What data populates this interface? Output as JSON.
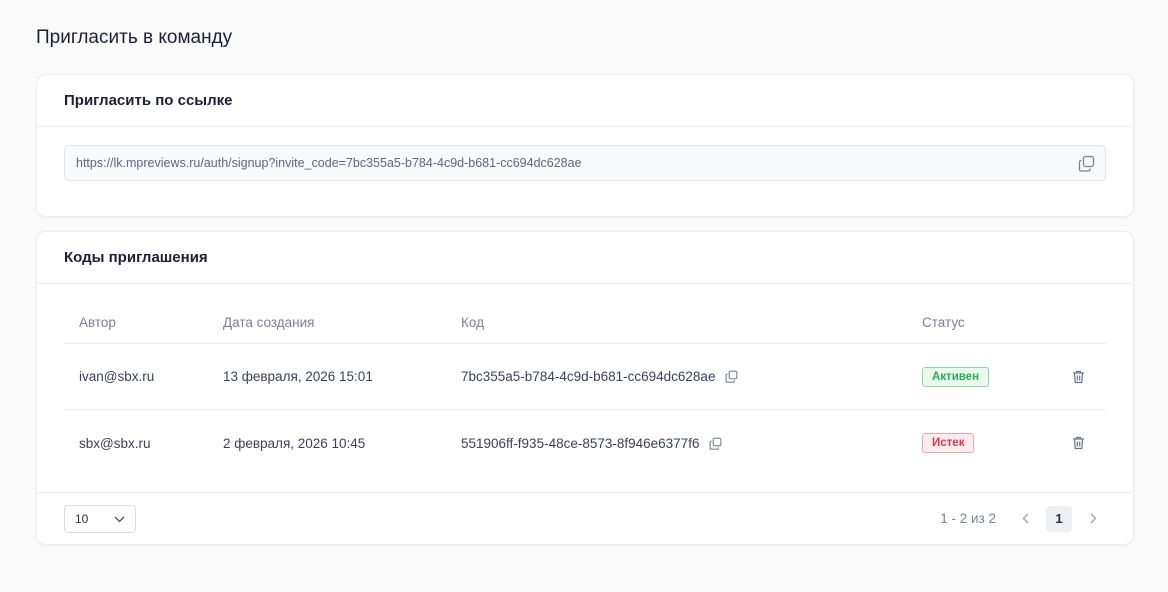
{
  "page": {
    "title": "Пригласить в команду"
  },
  "invite_link": {
    "title": "Пригласить по ссылке",
    "url": "https://lk.mpreviews.ru/auth/signup?invite_code=7bc355a5-b784-4c9d-b681-cc694dc628ae",
    "copy_icon": "copy-icon"
  },
  "codes": {
    "title": "Коды приглашения",
    "columns": {
      "author": "Автор",
      "date": "Дата создания",
      "code": "Код",
      "status": "Статус"
    },
    "rows": [
      {
        "author": "ivan@sbx.ru",
        "date": "13 февраля, 2026 15:01",
        "code": "7bc355a5-b784-4c9d-b681-cc694dc628ae",
        "status": "Активен",
        "status_color": "#2faa55"
      },
      {
        "author": "sbx@sbx.ru",
        "date": "2 февраля, 2026 10:45",
        "code": "551906ff-f935-48ce-8573-8f946e6377f6",
        "status": "Истек",
        "status_color": "#e0384f"
      }
    ]
  },
  "pagination": {
    "page_size": "10",
    "range": "1 - 2 из 2",
    "current_page": "1",
    "prev_icon": "chevron-left-icon",
    "next_icon": "chevron-right-icon"
  }
}
